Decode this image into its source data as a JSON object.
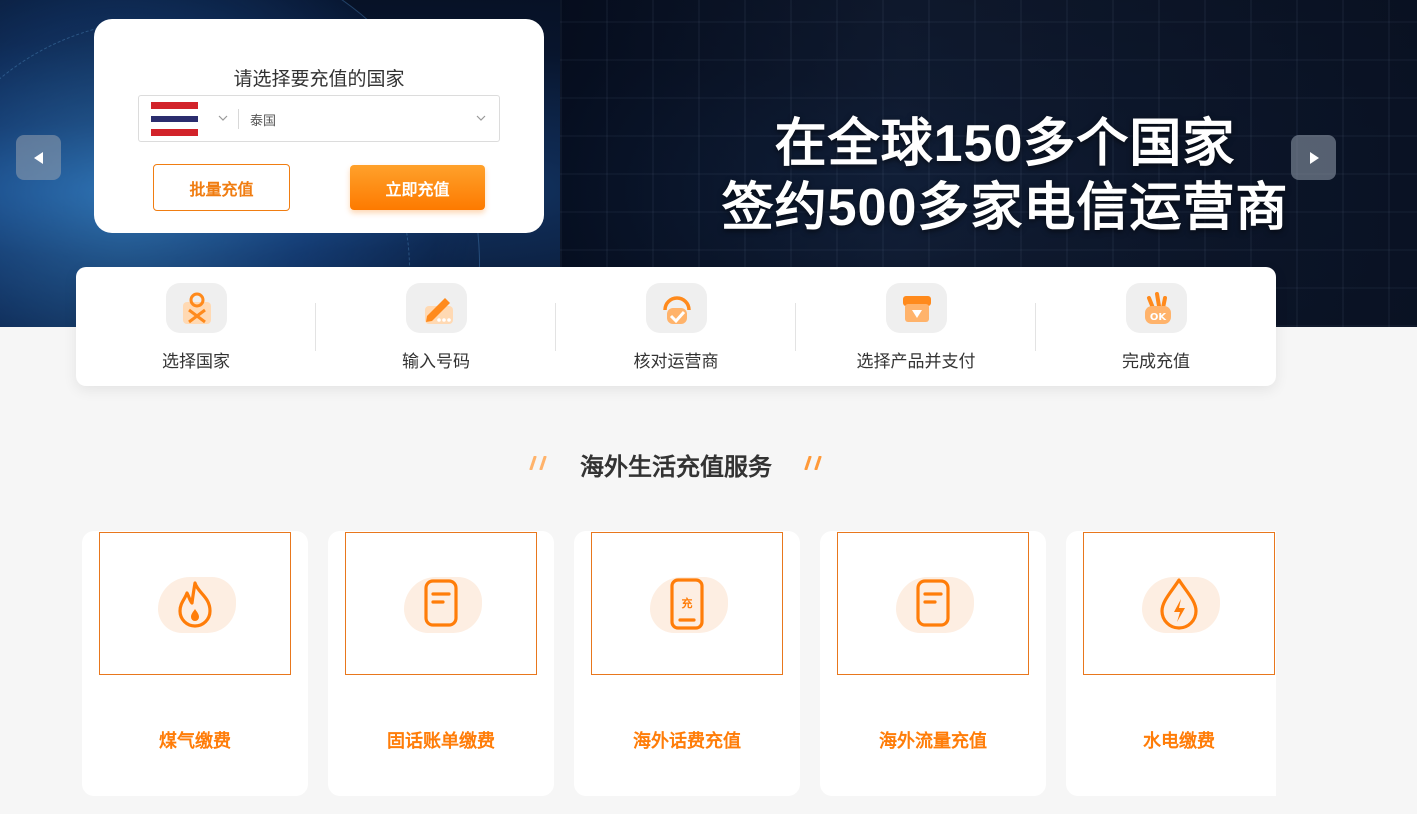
{
  "hero": {
    "headline_line1": "在全球150多个国家",
    "headline_line2": "签约500多家电信运营商",
    "prev_icon": "triangle-left-icon",
    "next_icon": "triangle-right-icon"
  },
  "select_card": {
    "title": "请选择要充值的国家",
    "country_flag": "thailand-flag",
    "country_name": "泰国",
    "batch_button": "批量充值",
    "now_button": "立即充值"
  },
  "steps": [
    {
      "label": "选择国家",
      "icon": "location-pin-icon"
    },
    {
      "label": "输入号码",
      "icon": "pencil-icon"
    },
    {
      "label": "核对运营商",
      "icon": "headset-check-icon"
    },
    {
      "label": "选择产品并支付",
      "icon": "shop-payment-icon"
    },
    {
      "label": "完成充值",
      "icon": "ok-hand-icon"
    }
  ],
  "section": {
    "title": "海外生活充值服务"
  },
  "services": [
    {
      "name": "煤气缴费",
      "icon": "flame-icon"
    },
    {
      "name": "固话账单缴费",
      "icon": "document-icon"
    },
    {
      "name": "海外话费充值",
      "icon": "phone-recharge-icon",
      "icon_text": "充"
    },
    {
      "name": "海外流量充值",
      "icon": "document-icon"
    },
    {
      "name": "水电缴费",
      "icon": "water-electric-icon"
    }
  ],
  "colors": {
    "accent": "#ff7d09",
    "button_gradient_top": "#ffa12b",
    "button_gradient_bottom": "#fd7a00",
    "hero_dark": "#08152d"
  }
}
